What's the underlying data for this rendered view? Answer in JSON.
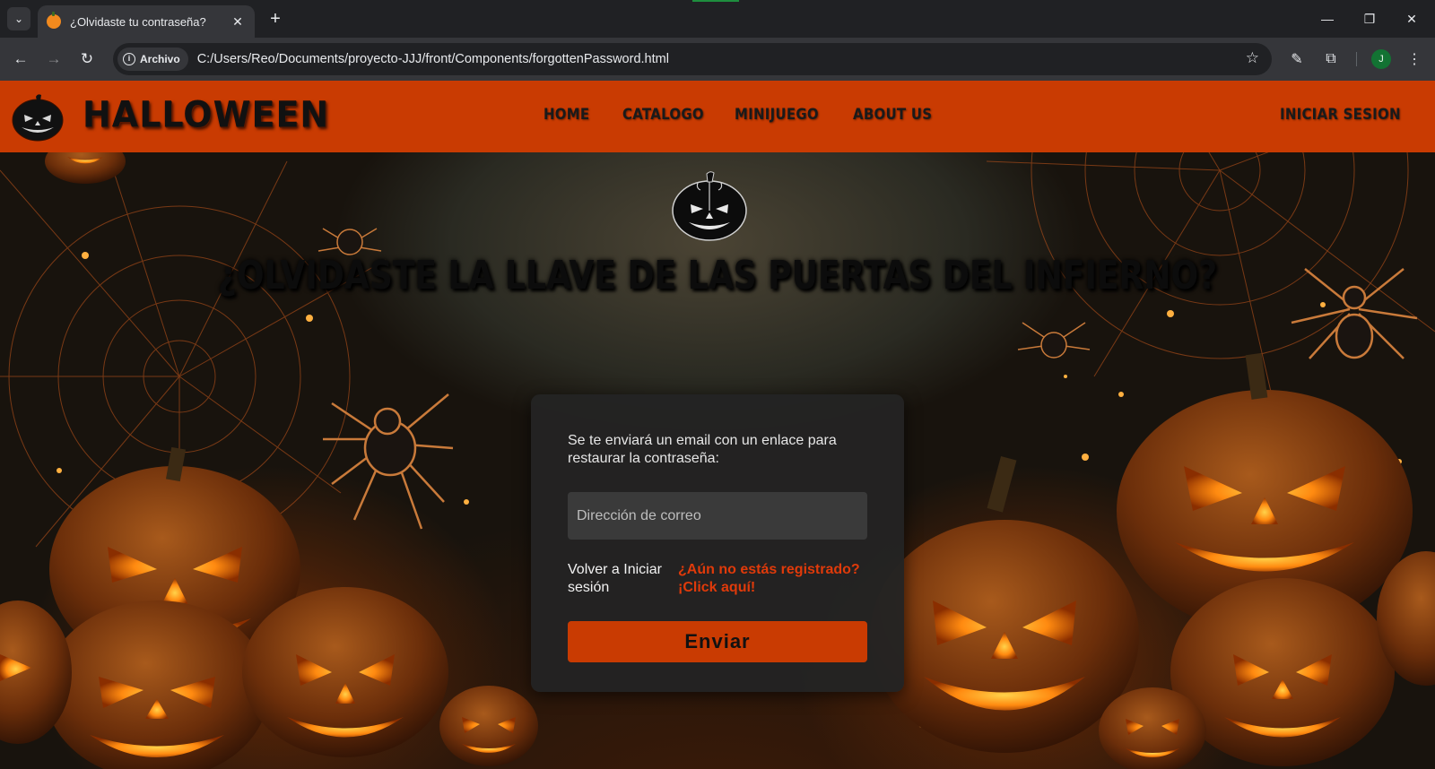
{
  "browser": {
    "tab_title": "¿Olvidaste tu contraseña?",
    "url_chip": "Archivo",
    "url": "C:/Users/Reo/Documents/proyecto-JJJ/front/Components/forgottenPassword.html",
    "profile_initial": "J"
  },
  "site": {
    "logo_text": "HALLOWEEN",
    "nav": [
      {
        "label": "HOME"
      },
      {
        "label": "CATALOGO"
      },
      {
        "label": "MINIJUEGO"
      },
      {
        "label": "ABOUT US"
      }
    ],
    "login_label": "INICIAR SESION",
    "brand_color": "#c93b02"
  },
  "main": {
    "heading": "¿OLVIDASTE LA LLAVE DE LAS PUERTAS DEL INFIERNO?",
    "form": {
      "description": "Se te enviará un email con un enlace para restaurar la contraseña:",
      "email_placeholder": "Dirección de correo",
      "email_value": "",
      "back_link": "Volver a Iniciar sesión",
      "register_link": "¿Aún no estás registrado? ¡Click aquí!",
      "submit_label": "Enviar"
    }
  }
}
